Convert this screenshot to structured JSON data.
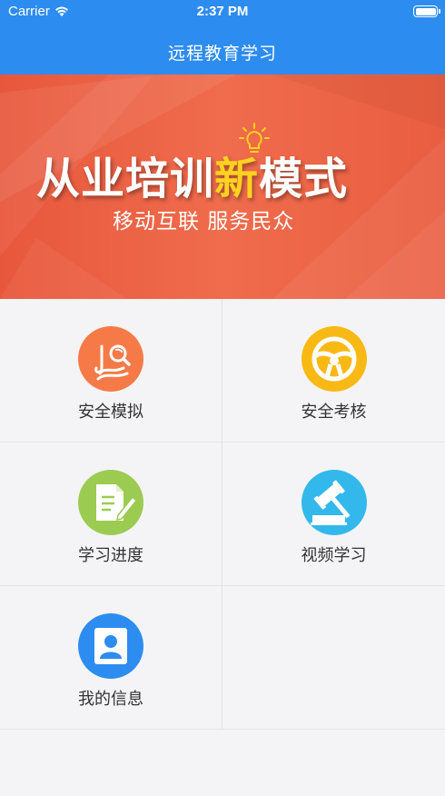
{
  "status_bar": {
    "carrier": "Carrier",
    "time": "2:37 PM"
  },
  "nav": {
    "title": "远程教育学习"
  },
  "banner": {
    "title_part1": "从业培训",
    "title_highlight": "新",
    "title_part2": "模式",
    "subtitle": "移动互联  服务民众",
    "bg_color": "#e8573c",
    "highlight_color": "#ffd21f"
  },
  "menu": {
    "items": [
      {
        "label": "安全模拟",
        "icon": "road-search-icon",
        "color": "#f67a47"
      },
      {
        "label": "安全考核",
        "icon": "steering-wheel-icon",
        "color": "#f9b914"
      },
      {
        "label": "学习进度",
        "icon": "document-edit-icon",
        "color": "#9ccb52"
      },
      {
        "label": "视频学习",
        "icon": "gavel-icon",
        "color": "#33b8ec"
      },
      {
        "label": "我的信息",
        "icon": "user-profile-icon",
        "color": "#2d8cf0"
      }
    ]
  },
  "colors": {
    "nav_bg": "#2d8cf0",
    "page_bg": "#f4f4f6"
  }
}
